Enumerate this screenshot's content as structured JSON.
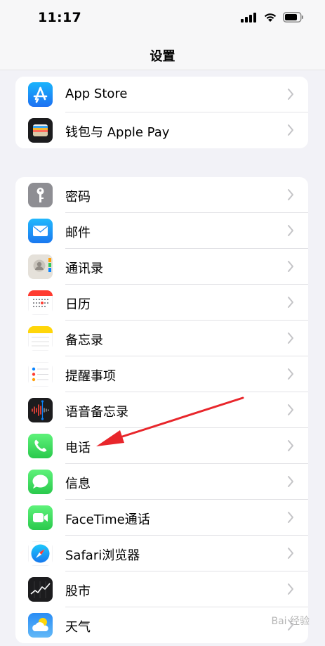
{
  "status_bar": {
    "time": "11:17"
  },
  "nav": {
    "title": "设置"
  },
  "groups": [
    [
      {
        "label": "App Store",
        "icon": "app-store-icon"
      },
      {
        "label": "钱包与 Apple Pay",
        "icon": "wallet-icon"
      }
    ],
    [
      {
        "label": "密码",
        "icon": "key-icon"
      },
      {
        "label": "邮件",
        "icon": "mail-icon"
      },
      {
        "label": "通讯录",
        "icon": "contacts-icon"
      },
      {
        "label": "日历",
        "icon": "calendar-icon"
      },
      {
        "label": "备忘录",
        "icon": "notes-icon"
      },
      {
        "label": "提醒事项",
        "icon": "reminders-icon"
      },
      {
        "label": "语音备忘录",
        "icon": "voice-memos-icon"
      },
      {
        "label": "电话",
        "icon": "phone-icon"
      },
      {
        "label": "信息",
        "icon": "messages-icon"
      },
      {
        "label": "FaceTime通话",
        "icon": "facetime-icon"
      },
      {
        "label": "Safari浏览器",
        "icon": "safari-icon"
      },
      {
        "label": "股市",
        "icon": "stocks-icon"
      },
      {
        "label": "天气",
        "icon": "weather-icon"
      }
    ]
  ],
  "watermark": "Bai 经验",
  "colors": {
    "accent_blue": "#1c8cf8",
    "arrow_red": "#e8262b",
    "background": "#f2f2f7"
  }
}
